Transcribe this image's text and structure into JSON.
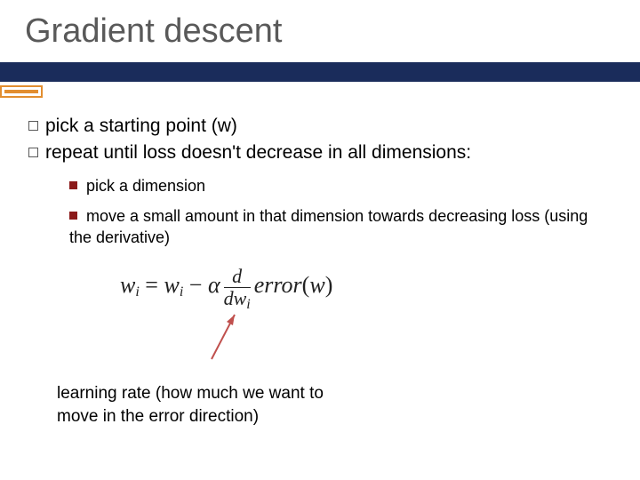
{
  "title": "Gradient descent",
  "bullets_l1": [
    "pick a starting point (w)",
    "repeat until loss doesn't decrease in all dimensions:"
  ],
  "bullets_l2": [
    "pick a dimension",
    "move a small amount in that dimension towards decreasing loss (using the derivative)"
  ],
  "formula": {
    "lhs_var": "w",
    "lhs_sub": "i",
    "eq": " = ",
    "rhs_var": "w",
    "rhs_sub": "i",
    "minus": " − ",
    "alpha": "α",
    "frac_num": "d",
    "frac_den_d": "dw",
    "frac_den_sub": "i",
    "err_fn": "error",
    "err_arg_open": "(",
    "err_arg": "w",
    "err_arg_close": ")"
  },
  "footnote": "learning rate (how much we want to move in the error direction)"
}
